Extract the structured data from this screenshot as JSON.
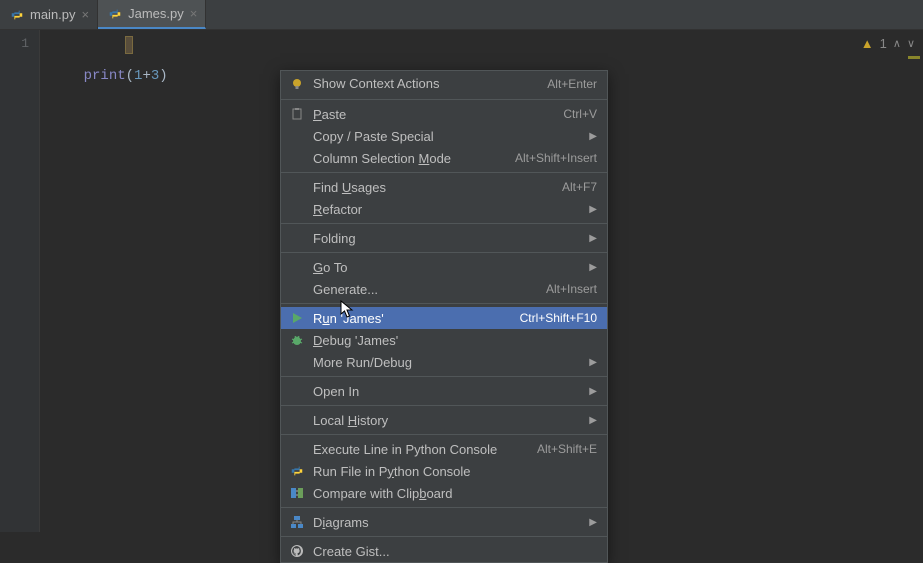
{
  "tabs": [
    {
      "label": "main.py"
    },
    {
      "label": "James.py"
    }
  ],
  "active_tab_index": 1,
  "editor": {
    "line_number": "1",
    "code": {
      "print": "print",
      "open": "(",
      "a": "1",
      "op": "+",
      "b": "3",
      "close": ")"
    }
  },
  "status": {
    "warn_count": "1"
  },
  "context_menu": {
    "items": [
      {
        "label_pre": "",
        "hot": "",
        "label_post": "Show Context Actions",
        "shortcut": "Alt+Enter",
        "icon": "bulb"
      },
      {
        "sep": true
      },
      {
        "label_pre": "",
        "hot": "P",
        "label_post": "aste",
        "shortcut": "Ctrl+V",
        "icon": "paste"
      },
      {
        "label_pre": "Copy / Paste Special",
        "shortcut": "",
        "submenu": true
      },
      {
        "label_pre": "Column Selection ",
        "hot": "M",
        "label_post": "ode",
        "shortcut": "Alt+Shift+Insert"
      },
      {
        "sep": true
      },
      {
        "label_pre": "Find ",
        "hot": "U",
        "label_post": "sages",
        "shortcut": "Alt+F7"
      },
      {
        "label_pre": "",
        "hot": "R",
        "label_post": "efactor",
        "submenu": true
      },
      {
        "sep": true
      },
      {
        "label_pre": "Folding",
        "submenu": true
      },
      {
        "sep": true
      },
      {
        "label_pre": "",
        "hot": "G",
        "label_post": "o To",
        "submenu": true
      },
      {
        "label_pre": "Generate...",
        "shortcut": "Alt+Insert"
      },
      {
        "sep": true
      },
      {
        "label_pre": "R",
        "hot": "u",
        "label_post": "n 'James'",
        "shortcut": "Ctrl+Shift+F10",
        "icon": "run",
        "selected": true
      },
      {
        "label_pre": "",
        "hot": "D",
        "label_post": "ebug 'James'",
        "icon": "bug"
      },
      {
        "label_pre": "More Run/Debug",
        "submenu": true
      },
      {
        "sep": true
      },
      {
        "label_pre": "Open In",
        "submenu": true
      },
      {
        "sep": true
      },
      {
        "label_pre": "Local ",
        "hot": "H",
        "label_post": "istory",
        "submenu": true
      },
      {
        "sep": true
      },
      {
        "label_pre": "Execute Line in Python Console",
        "shortcut": "Alt+Shift+E"
      },
      {
        "label_pre": "Run File in P",
        "hot": "y",
        "label_post": "thon Console",
        "icon": "py"
      },
      {
        "label_pre": "Compare with Clip",
        "hot": "b",
        "label_post": "oard",
        "icon": "diff"
      },
      {
        "sep": true
      },
      {
        "label_pre": "D",
        "hot": "i",
        "label_post": "agrams",
        "icon": "uml",
        "submenu": true
      },
      {
        "sep": true
      },
      {
        "label_pre": "Create Gist...",
        "icon": "github"
      }
    ]
  }
}
